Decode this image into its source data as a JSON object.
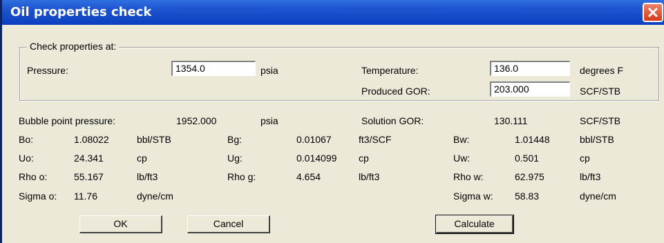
{
  "window": {
    "title": "Oil properties check"
  },
  "group": {
    "legend": "Check properties at:",
    "pressure_label": "Pressure:",
    "pressure_value": "1354.0",
    "pressure_unit": "psia",
    "temperature_label": "Temperature:",
    "temperature_value": "136.0",
    "temperature_unit": "degrees F",
    "gor_label": "Produced GOR:",
    "gor_value": "203.000",
    "gor_unit": "SCF/STB"
  },
  "results": {
    "bubble_label": "Bubble point pressure:",
    "bubble_value": "1952.000",
    "bubble_unit": "psia",
    "sgor_label": "Solution GOR:",
    "sgor_value": "130.111",
    "sgor_unit": "SCF/STB",
    "bo_label": "Bo:",
    "bo_value": "1.08022",
    "bo_unit": "bbl/STB",
    "bg_label": "Bg:",
    "bg_value": "0.01067",
    "bg_unit": "ft3/SCF",
    "bw_label": "Bw:",
    "bw_value": "1.01448",
    "bw_unit": "bbl/STB",
    "uo_label": "Uo:",
    "uo_value": "24.341",
    "uo_unit": "cp",
    "ug_label": "Ug:",
    "ug_value": "0.014099",
    "ug_unit": "cp",
    "uw_label": "Uw:",
    "uw_value": "0.501",
    "uw_unit": "cp",
    "rhoo_label": "Rho o:",
    "rhoo_value": "55.167",
    "rhoo_unit": "lb/ft3",
    "rhog_label": "Rho g:",
    "rhog_value": "4.654",
    "rhog_unit": "lb/ft3",
    "rhow_label": "Rho w:",
    "rhow_value": "62.975",
    "rhow_unit": "lb/ft3",
    "sigmao_label": "Sigma o:",
    "sigmao_value": "11.76",
    "sigmao_unit": "dyne/cm",
    "sigmaw_label": "Sigma w:",
    "sigmaw_value": "58.83",
    "sigmaw_unit": "dyne/cm"
  },
  "buttons": {
    "ok": "OK",
    "cancel": "Cancel",
    "calculate": "Calculate"
  },
  "icons": {
    "close": "close-icon"
  },
  "colors": {
    "titlebar": "#0b3fbf",
    "close": "#d43a1a",
    "dialog_bg": "#ece9d8"
  }
}
